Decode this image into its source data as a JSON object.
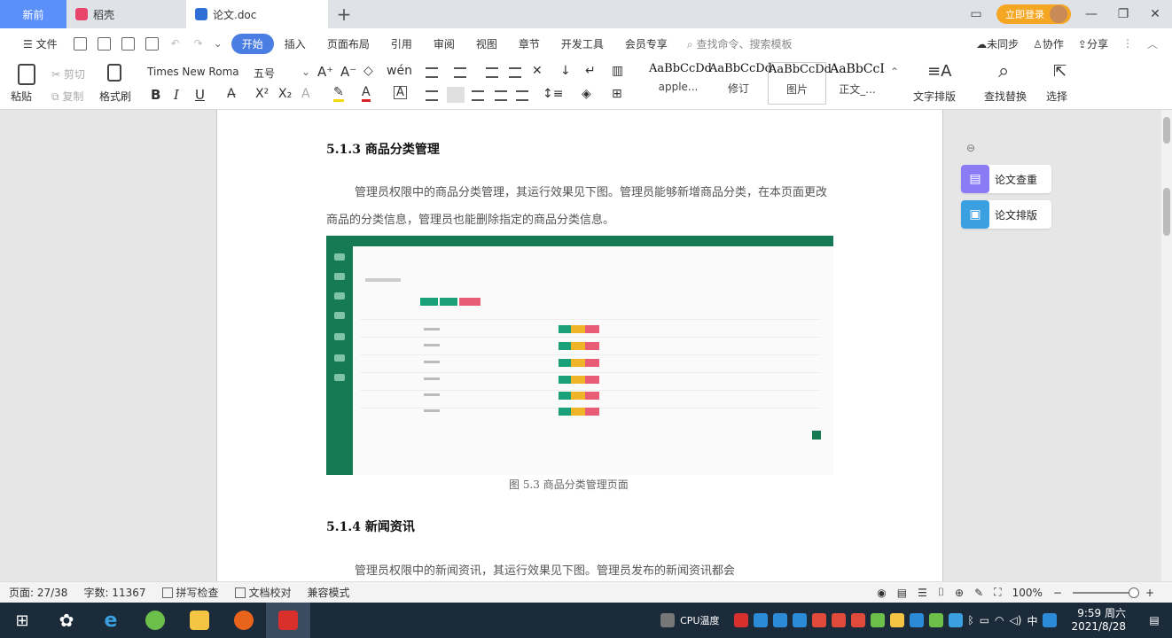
{
  "tabs": {
    "home": "新前",
    "daoke": "稻壳",
    "doc": "论文.doc",
    "login": "立即登录"
  },
  "menu": {
    "file": "文件",
    "items": [
      "开始",
      "插入",
      "页面布局",
      "引用",
      "审阅",
      "视图",
      "章节",
      "开发工具",
      "会员专享"
    ],
    "search": "查找命令、搜索模板",
    "sync": "未同步",
    "collab": "协作",
    "share": "分享"
  },
  "ribbon": {
    "paste": "粘贴",
    "cut": "剪切",
    "copy": "复制",
    "format_painter": "格式刷",
    "font_name": "Times New Roma",
    "font_size": "五号",
    "bold": "B",
    "italic": "I",
    "underline": "U",
    "styles": [
      {
        "sample": "AaBbCcDd",
        "label": "apple..."
      },
      {
        "sample": "AaBbCcDd",
        "label": "修订"
      },
      {
        "sample": "AaBbCcDd",
        "label": "图片"
      },
      {
        "sample": "AaBbCcI",
        "label": "正文_..."
      }
    ],
    "text_layout": "文字排版",
    "find_replace": "查找替换",
    "select": "选择"
  },
  "document": {
    "heading1": "5.1.3 商品分类管理",
    "para1": "管理员权限中的商品分类管理，其运行效果见下图。管理员能够新增商品分类，在本页面更改商品的分类信息，管理员也能删除指定的商品分类信息。",
    "caption": "图 5.3 商品分类管理页面",
    "heading2": "5.1.4 新闻资讯",
    "para2": "管理员权限中的新闻资讯，其运行效果见下图。管理员发布的新闻资讯都会"
  },
  "side_panel": {
    "check": "论文查重",
    "layout": "论文排版"
  },
  "status": {
    "page": "页面: 27/38",
    "words": "字数: 11367",
    "spell": "拼写检查",
    "proof": "文档校对",
    "compat": "兼容模式",
    "zoom": "100%"
  },
  "taskbar": {
    "cpu": "CPU温度",
    "time": "9:59 周六",
    "date": "2021/8/28"
  },
  "colors": {
    "accent": "#4a7ee3",
    "figure_green": "#167a55",
    "taskbar": "#1c2b3a",
    "login": "#f5a623"
  }
}
